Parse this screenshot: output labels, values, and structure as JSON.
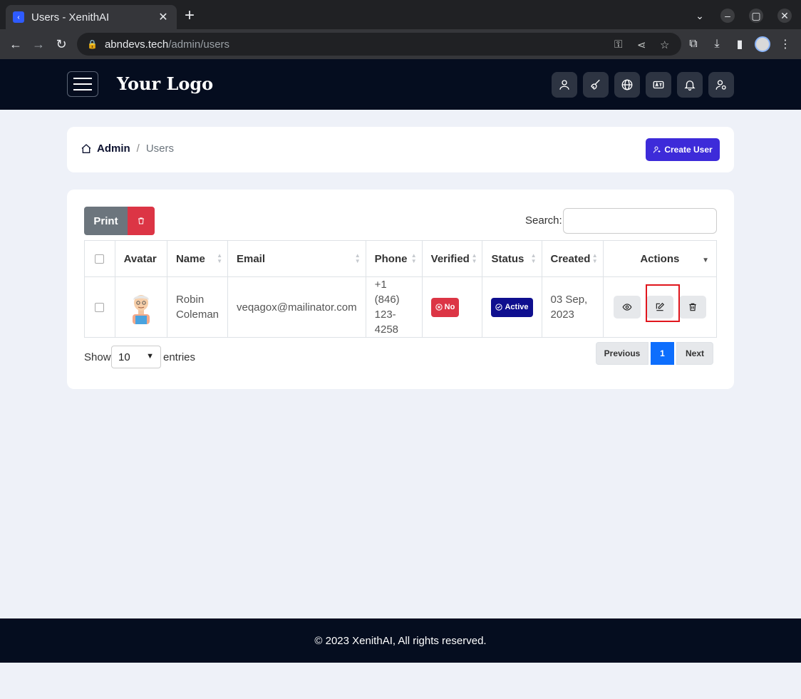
{
  "browser": {
    "tab_title": "Users - XenithAI",
    "url_host": "abndevs.tech",
    "url_path": "/admin/users"
  },
  "header": {
    "logo": "Your Logo",
    "icons": [
      "user-icon",
      "broom-icon",
      "globe-icon",
      "language-icon",
      "bell-icon",
      "user-settings-icon"
    ]
  },
  "breadcrumb": {
    "admin": "Admin",
    "separator": "/",
    "current": "Users"
  },
  "create_button": "Create User",
  "table_controls": {
    "print": "Print",
    "search_label": "Search:",
    "search_value": ""
  },
  "table": {
    "columns": [
      "Avatar",
      "Name",
      "Email",
      "Phone",
      "Verified",
      "Status",
      "Created",
      "Actions"
    ],
    "rows": [
      {
        "name": "Robin Coleman",
        "email": "veqagox@mailinator.com",
        "phone": "+1 (846) 123-4258",
        "verified": "No",
        "status": "Active",
        "created": "03 Sep, 2023"
      }
    ]
  },
  "footer_controls": {
    "show": "Show",
    "page_length": "10",
    "entries": "entries",
    "previous": "Previous",
    "page": "1",
    "next": "Next"
  },
  "footer": "© 2023 XenithAI, All rights reserved."
}
